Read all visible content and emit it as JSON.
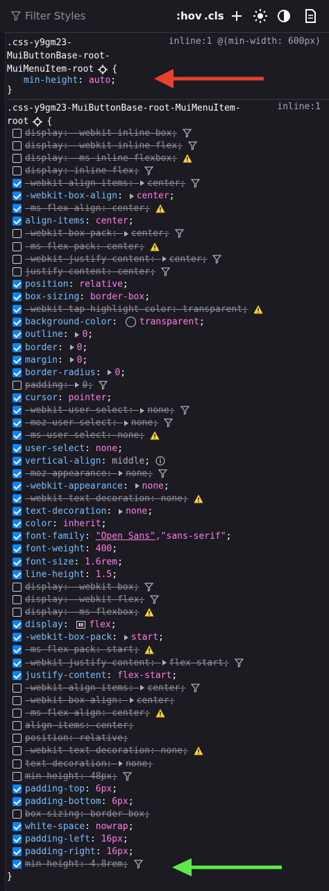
{
  "toolbar": {
    "filter_placeholder": "Filter Styles",
    "hov_label": ":hov",
    "cls_label": ".cls"
  },
  "rule1": {
    "selector_line1": ".css-y9gm23-",
    "selector_line2": "MuiButtonBase-root-",
    "selector_line3": "MuiMenuItem-root",
    "source": "inline:1 @(min-width: 600px)",
    "open_brace": "{",
    "close_brace": "}",
    "declaration": {
      "name": "min-height",
      "value": "auto"
    }
  },
  "rule2": {
    "selector_line1": ".css-y9gm23-MuiButtonBase-root-MuiMenuItem-",
    "selector_line2": "root",
    "source": "inline:1",
    "open_brace": "{",
    "close_brace": "}"
  },
  "declarations": [
    {
      "name": "display",
      "value": "-webkit-inline-box",
      "checked": false,
      "struck": true,
      "icon": "filter"
    },
    {
      "name": "display",
      "value": "-webkit-inline-flex",
      "checked": false,
      "struck": true,
      "icon": "filter"
    },
    {
      "name": "display",
      "value": "-ms-inline-flexbox",
      "checked": false,
      "struck": true,
      "icon": "warning"
    },
    {
      "name": "display",
      "value": "inline-flex",
      "checked": false,
      "struck": true,
      "icon": "filter"
    },
    {
      "name": "-webkit-align-items",
      "value": "center",
      "checked": true,
      "struck": true,
      "icon": "filter",
      "tri": true
    },
    {
      "name": "-webkit-box-align",
      "value": "center",
      "checked": true,
      "struck": false,
      "icon": "",
      "tri": true
    },
    {
      "name": "-ms-flex-align",
      "value": "center",
      "checked": true,
      "struck": true,
      "icon": "warning"
    },
    {
      "name": "align-items",
      "value": "center",
      "checked": true,
      "struck": false,
      "icon": ""
    },
    {
      "name": "-webkit-box-pack",
      "value": "center",
      "checked": false,
      "struck": true,
      "icon": "filter",
      "tri": true
    },
    {
      "name": "-ms-flex-pack",
      "value": "center",
      "checked": false,
      "struck": true,
      "icon": "warning"
    },
    {
      "name": "-webkit-justify-content",
      "value": "center",
      "checked": false,
      "struck": true,
      "icon": "filter",
      "tri": true
    },
    {
      "name": "justify-content",
      "value": "center",
      "checked": false,
      "struck": true,
      "icon": "filter"
    },
    {
      "name": "position",
      "value": "relative",
      "checked": true,
      "struck": false,
      "icon": ""
    },
    {
      "name": "box-sizing",
      "value": "border-box",
      "checked": true,
      "struck": false,
      "icon": ""
    },
    {
      "name": "-webkit-tap-highlight-color",
      "value": "transparent",
      "checked": true,
      "struck": true,
      "icon": "warning"
    },
    {
      "name": "background-color",
      "value": "transparent",
      "checked": true,
      "struck": false,
      "icon": "",
      "swatch": true
    },
    {
      "name": "outline",
      "value": "0",
      "checked": true,
      "struck": false,
      "icon": "",
      "tri": true
    },
    {
      "name": "border",
      "value": "0",
      "checked": true,
      "struck": false,
      "icon": "",
      "tri": true
    },
    {
      "name": "margin",
      "value": "0",
      "checked": true,
      "struck": false,
      "icon": "",
      "tri": true
    },
    {
      "name": "border-radius",
      "value": "0",
      "checked": true,
      "struck": false,
      "icon": "",
      "tri": true
    },
    {
      "name": "padding",
      "value": "0",
      "checked": false,
      "struck": true,
      "icon": "filter",
      "tri": true
    },
    {
      "name": "cursor",
      "value": "pointer",
      "checked": true,
      "struck": false,
      "icon": ""
    },
    {
      "name": "-webkit-user-select",
      "value": "none",
      "checked": true,
      "struck": true,
      "icon": "filter",
      "tri": true
    },
    {
      "name": "-moz-user-select",
      "value": "none",
      "checked": true,
      "struck": true,
      "icon": "filter",
      "tri": true
    },
    {
      "name": "-ms-user-select",
      "value": "none",
      "checked": true,
      "struck": true,
      "icon": "warning"
    },
    {
      "name": "user-select",
      "value": "none",
      "checked": true,
      "struck": false,
      "icon": ""
    },
    {
      "name": "vertical-align",
      "value": "middle",
      "checked": true,
      "struck": false,
      "icon": "info",
      "dim": true
    },
    {
      "name": "-moz-appearance",
      "value": "none",
      "checked": true,
      "struck": true,
      "icon": "filter",
      "tri": true
    },
    {
      "name": "-webkit-appearance",
      "value": "none",
      "checked": true,
      "struck": false,
      "icon": "",
      "tri": true
    },
    {
      "name": "-webkit-text-decoration",
      "value": "none",
      "checked": true,
      "struck": true,
      "icon": "warning"
    },
    {
      "name": "text-decoration",
      "value": "none",
      "checked": true,
      "struck": false,
      "icon": "",
      "tri": true
    },
    {
      "name": "color",
      "value": "inherit",
      "checked": true,
      "struck": false,
      "icon": ""
    },
    {
      "name": "font-family",
      "value": "\"Open Sans\",\"sans-serif\"",
      "checked": true,
      "struck": false,
      "icon": "",
      "font": true
    },
    {
      "name": "font-weight",
      "value": "400",
      "checked": true,
      "struck": false,
      "icon": ""
    },
    {
      "name": "font-size",
      "value": "1.6rem",
      "checked": true,
      "struck": false,
      "icon": ""
    },
    {
      "name": "line-height",
      "value": "1.5",
      "checked": true,
      "struck": false,
      "icon": ""
    },
    {
      "name": "display",
      "value": "-webkit-box",
      "checked": false,
      "struck": true,
      "icon": "filter"
    },
    {
      "name": "display",
      "value": "-webkit-flex",
      "checked": false,
      "struck": true,
      "icon": "filter"
    },
    {
      "name": "display",
      "value": "-ms-flexbox",
      "checked": false,
      "struck": true,
      "icon": "warning"
    },
    {
      "name": "display",
      "value": "flex",
      "checked": true,
      "struck": false,
      "icon": "",
      "grid": true
    },
    {
      "name": "-webkit-box-pack",
      "value": "start",
      "checked": true,
      "struck": false,
      "icon": "",
      "tri": true
    },
    {
      "name": "-ms-flex-pack",
      "value": "start",
      "checked": true,
      "struck": true,
      "icon": "warning"
    },
    {
      "name": "-webkit-justify-content",
      "value": "flex-start",
      "checked": true,
      "struck": true,
      "icon": "filter",
      "tri": true
    },
    {
      "name": "justify-content",
      "value": "flex-start",
      "checked": true,
      "struck": false,
      "icon": ""
    },
    {
      "name": "-webkit-align-items",
      "value": "center",
      "checked": false,
      "struck": true,
      "icon": "filter",
      "tri": true
    },
    {
      "name": "-webkit-box-align",
      "value": "center",
      "checked": false,
      "struck": true,
      "icon": "",
      "tri": true
    },
    {
      "name": "-ms-flex-align",
      "value": "center",
      "checked": false,
      "struck": true,
      "icon": "warning"
    },
    {
      "name": "align-items",
      "value": "center",
      "checked": false,
      "struck": true,
      "icon": ""
    },
    {
      "name": "position",
      "value": "relative",
      "checked": false,
      "struck": true,
      "icon": ""
    },
    {
      "name": "-webkit-text-decoration",
      "value": "none",
      "checked": false,
      "struck": true,
      "icon": "warning"
    },
    {
      "name": "text-decoration",
      "value": "none",
      "checked": false,
      "struck": true,
      "icon": "",
      "tri": true
    },
    {
      "name": "min-height",
      "value": "48px",
      "checked": false,
      "struck": true,
      "icon": "filter"
    },
    {
      "name": "padding-top",
      "value": "6px",
      "checked": true,
      "struck": false,
      "icon": ""
    },
    {
      "name": "padding-bottom",
      "value": "6px",
      "checked": true,
      "struck": false,
      "icon": ""
    },
    {
      "name": "box-sizing",
      "value": "border-box",
      "checked": false,
      "struck": true,
      "icon": ""
    },
    {
      "name": "white-space",
      "value": "nowrap",
      "checked": true,
      "struck": false,
      "icon": ""
    },
    {
      "name": "padding-left",
      "value": "16px",
      "checked": true,
      "struck": false,
      "icon": ""
    },
    {
      "name": "padding-right",
      "value": "16px",
      "checked": true,
      "struck": false,
      "icon": ""
    },
    {
      "name": "min-height",
      "value": "4.8rem",
      "checked": true,
      "struck": true,
      "icon": "filter"
    }
  ],
  "colors": {
    "red_arrow": "#e8412c",
    "green_arrow": "#5ee84a",
    "checkbox": "#0a84ff",
    "property": "#75bfff",
    "value": "#ff7de9",
    "warning": "#ffd52e"
  }
}
